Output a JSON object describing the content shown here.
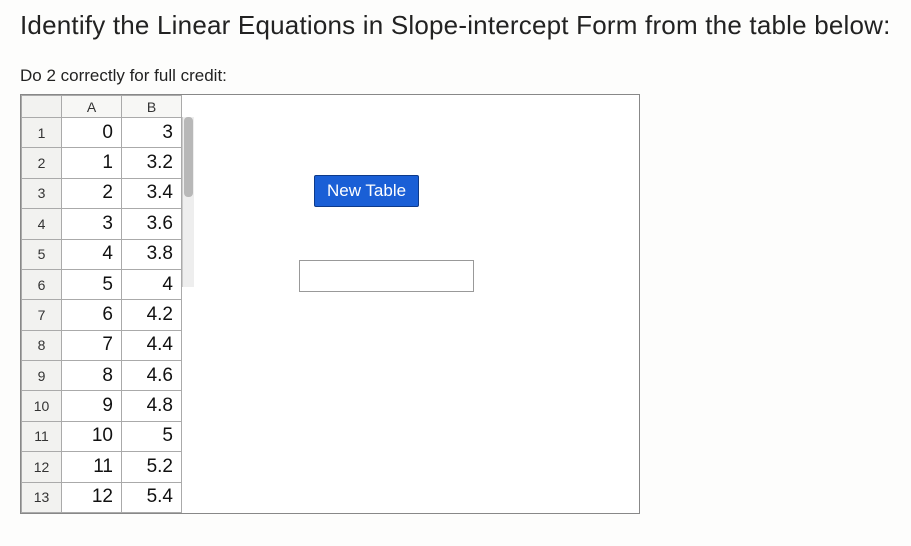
{
  "title": "Identify the Linear Equations in Slope-intercept Form from the table below:",
  "subtitle": "Do 2 correctly for full credit:",
  "columns": {
    "a": "A",
    "b": "B"
  },
  "rows": [
    {
      "n": "1",
      "a": "0",
      "b": "3"
    },
    {
      "n": "2",
      "a": "1",
      "b": "3.2"
    },
    {
      "n": "3",
      "a": "2",
      "b": "3.4"
    },
    {
      "n": "4",
      "a": "3",
      "b": "3.6"
    },
    {
      "n": "5",
      "a": "4",
      "b": "3.8"
    },
    {
      "n": "6",
      "a": "5",
      "b": "4"
    },
    {
      "n": "7",
      "a": "6",
      "b": "4.2"
    },
    {
      "n": "8",
      "a": "7",
      "b": "4.4"
    },
    {
      "n": "9",
      "a": "8",
      "b": "4.6"
    },
    {
      "n": "10",
      "a": "9",
      "b": "4.8"
    },
    {
      "n": "11",
      "a": "10",
      "b": "5"
    },
    {
      "n": "12",
      "a": "11",
      "b": "5.2"
    },
    {
      "n": "13",
      "a": "12",
      "b": "5.4"
    }
  ],
  "button": {
    "new_table": "New Table"
  },
  "input": {
    "answer": ""
  },
  "chart_data": {
    "type": "table",
    "title": "Identify the Linear Equations in Slope-intercept Form from the table below:",
    "columns": [
      "A",
      "B"
    ],
    "series": [
      {
        "name": "A",
        "values": [
          0,
          1,
          2,
          3,
          4,
          5,
          6,
          7,
          8,
          9,
          10,
          11,
          12
        ]
      },
      {
        "name": "B",
        "values": [
          3,
          3.2,
          3.4,
          3.6,
          3.8,
          4,
          4.2,
          4.4,
          4.6,
          4.8,
          5,
          5.2,
          5.4
        ]
      }
    ]
  }
}
